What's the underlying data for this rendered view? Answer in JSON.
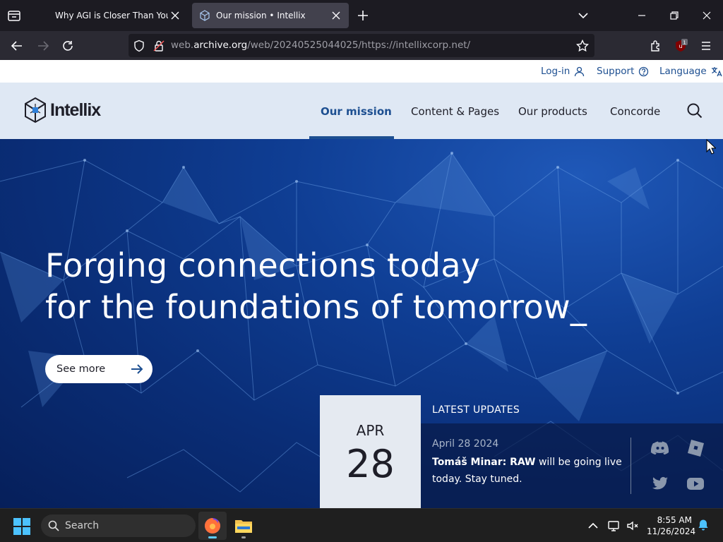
{
  "browser": {
    "tabs": [
      {
        "title": "Why AGI is Closer Than You Thi",
        "active": false
      },
      {
        "title": "Our mission • Intellix",
        "active": true
      }
    ],
    "url_prefix": "web.",
    "url_domain": "archive.org",
    "url_rest": "/web/20240525044025/https://intellixcorp.net/",
    "extension_badge": "1"
  },
  "site": {
    "top_links": {
      "login": "Log-in",
      "support": "Support",
      "language": "Language"
    },
    "brand": "Intellix",
    "nav": [
      {
        "label": "Our mission",
        "active": true
      },
      {
        "label": "Content & Pages",
        "active": false
      },
      {
        "label": "Our products",
        "active": false
      },
      {
        "label": "Concorde",
        "active": false
      }
    ],
    "hero": {
      "line1": "Forging connections today",
      "line2": "for the foundations of tomorrow_",
      "cta": "See more"
    },
    "latest": {
      "label": "LATEST UPDATES",
      "month": "APR",
      "day": "28",
      "date": "April 28 2024",
      "author": "Tomáš Minar: RAW",
      "text": " will be going live today. Stay tuned."
    },
    "social_icons": [
      "discord-icon",
      "roblox-icon",
      "twitter-icon",
      "youtube-icon"
    ]
  },
  "taskbar": {
    "search_placeholder": "Search",
    "time": "8:55 AM",
    "date": "11/26/2024"
  },
  "colors": {
    "accent": "#1d4f91",
    "header_bg": "#dfe8f4",
    "hero_bg": "#0a2e78",
    "browser_bg": "#1c1b22"
  }
}
